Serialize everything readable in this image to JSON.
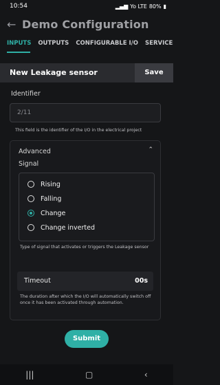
{
  "status_bar": {
    "time": "10:54",
    "battery": "80%",
    "network": "Yo LTE"
  },
  "app_bar": {
    "title": "Demo Configuration"
  },
  "tabs": [
    {
      "label": "INPUTS",
      "active": true
    },
    {
      "label": "OUTPUTS",
      "active": false
    },
    {
      "label": "CONFIGURABLE I/O",
      "active": false
    },
    {
      "label": "SERVICES",
      "active": false
    }
  ],
  "header": {
    "title": "New Leakage sensor",
    "save_label": "Save"
  },
  "identifier": {
    "label": "Identifier",
    "value": "2/11",
    "help": "This field is the identifier of the I/O in the electrical project"
  },
  "advanced": {
    "label": "Advanced",
    "signal_label": "Signal",
    "options": [
      "Rising",
      "Falling",
      "Change",
      "Change inverted"
    ],
    "selected": "Change",
    "signal_help": "Type of signal that activates or triggers the Leakage sensor",
    "timeout_label": "Timeout",
    "timeout_value": "00s",
    "timeout_help": "The duration after which the I/O will automatically switch off once it has been activated through automation."
  },
  "submit_label": "Submit",
  "colors": {
    "accent": "#2fb0a6",
    "background": "#151618"
  }
}
